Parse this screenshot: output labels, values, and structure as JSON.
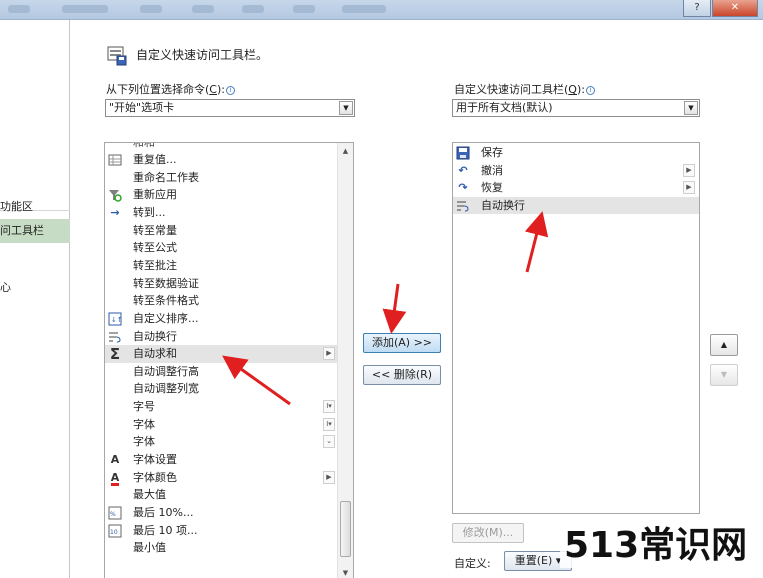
{
  "window": {
    "help_label": "?",
    "close_label": "✕"
  },
  "leftnav": {
    "items": [
      {
        "label": "功能区",
        "selected": false
      },
      {
        "label": "问工具栏",
        "selected": true
      }
    ],
    "extra": "心"
  },
  "header": {
    "title": "自定义快速访问工具栏。",
    "icon": "quick-access-icon"
  },
  "commands": {
    "label": "从下列位置选择命令(",
    "hotkey": "C",
    "label_end": "):",
    "selected": "\"开始\"选项卡",
    "items": [
      {
        "icon": "table-icon",
        "label": "重复值..."
      },
      {
        "icon": "",
        "label": "重命名工作表"
      },
      {
        "icon": "reapply-filter-icon",
        "label": "重新应用"
      },
      {
        "icon": "arrow-right-icon",
        "label": "转到..."
      },
      {
        "icon": "",
        "label": "转至常量"
      },
      {
        "icon": "",
        "label": "转至公式"
      },
      {
        "icon": "",
        "label": "转至批注"
      },
      {
        "icon": "",
        "label": "转至数据验证"
      },
      {
        "icon": "",
        "label": "转至条件格式"
      },
      {
        "icon": "custom-sort-icon",
        "label": "自定义排序..."
      },
      {
        "icon": "wrap-text-icon",
        "label": "自动换行"
      },
      {
        "icon": "sigma-icon",
        "label": "自动求和",
        "highlight": true,
        "submenu": true
      },
      {
        "icon": "",
        "label": "自动调整行高"
      },
      {
        "icon": "",
        "label": "自动调整列宽"
      },
      {
        "icon": "",
        "label": "字号",
        "side": "I▾"
      },
      {
        "icon": "",
        "label": "字体",
        "side": "I▾"
      },
      {
        "icon": "",
        "label": "字体",
        "side": "⌄"
      },
      {
        "icon": "font-a-icon",
        "label": "字体设置"
      },
      {
        "icon": "font-color-icon",
        "label": "字体颜色",
        "submenu": true
      },
      {
        "icon": "",
        "label": "最大值"
      },
      {
        "icon": "top10-percent-icon",
        "label": "最后 10%..."
      },
      {
        "icon": "top10-items-icon",
        "label": "最后 10 项..."
      },
      {
        "icon": "",
        "label": "最小值"
      }
    ]
  },
  "toolbar": {
    "label": "自定义快速访问工具栏(",
    "hotkey": "Q",
    "label_end": "):",
    "selected": "用于所有文档(默认)",
    "items": [
      {
        "icon": "save-icon",
        "label": "保存"
      },
      {
        "icon": "undo-icon",
        "label": "撤消",
        "submenu": true
      },
      {
        "icon": "redo-icon",
        "label": "恢复",
        "submenu": true
      },
      {
        "icon": "wrap-text-icon",
        "label": "自动换行",
        "highlight": true
      }
    ]
  },
  "buttons": {
    "add": "添加(A) >>",
    "remove": "<< 删除(R)",
    "modify": "修改(M)...",
    "customize_label": "自定义:",
    "reset": "重置(E) ▾",
    "move_up": "▲",
    "move_down": "▼"
  },
  "watermark": "513常识网",
  "colors": {
    "selected_nav": "#c6dcc4",
    "arrow": "#e02020",
    "highlight_row": "#e4e4e4"
  }
}
